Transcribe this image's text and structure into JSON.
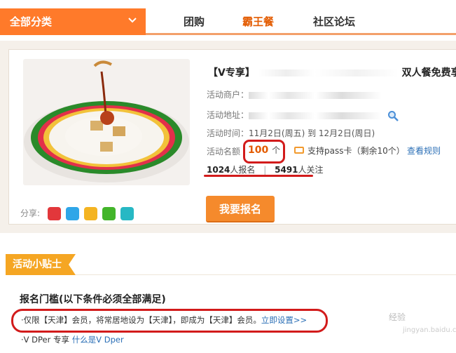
{
  "nav": {
    "category_label": "全部分类",
    "tabs": [
      {
        "label": "团购"
      },
      {
        "label": "霸王餐",
        "active": true
      },
      {
        "label": "社区论坛"
      }
    ]
  },
  "deal": {
    "title_prefix": "【V专享】",
    "title_suffix": "双人餐免费享",
    "merchant_label": "活动商户：",
    "address_label": "活动地址：",
    "time_label": "活动时间：",
    "time_value": "11月2日(周五) 到 12月2日(周日)",
    "quota_label": "活动名额",
    "quota_value": "100",
    "quota_unit": "个",
    "pass_text": "支持pass卡（剩余10个）",
    "rules_link": "查看规则",
    "signup_count": "1024",
    "signup_suffix": "人报名",
    "separator": "|",
    "follow_count": "5491",
    "follow_suffix": "人关注",
    "signup_button": "我要报名"
  },
  "share": {
    "label": "分享:",
    "icons": [
      "weibo-icon",
      "pinterest-icon",
      "star-icon",
      "wechat-icon",
      "copy-icon"
    ]
  },
  "tips": {
    "tag_label": "活动小贴士",
    "req_title": "报名门槛(以下条件必须全部满足)",
    "req_item1": "·仅限【天津】会员，将常居地设为【天津】，即成为【天津】会员。",
    "req_item1_link": "立即设置>>",
    "req_item2": "·V DPer 专享",
    "req_item2_link": "什么是V Dper"
  },
  "colors": {
    "accent": "#ff7a2a",
    "highlight": "#d21b1b",
    "link": "#2b6fb6",
    "tag": "#f5a623"
  },
  "watermark": "经验",
  "watermark_sub": "jingyan.baidu.com"
}
